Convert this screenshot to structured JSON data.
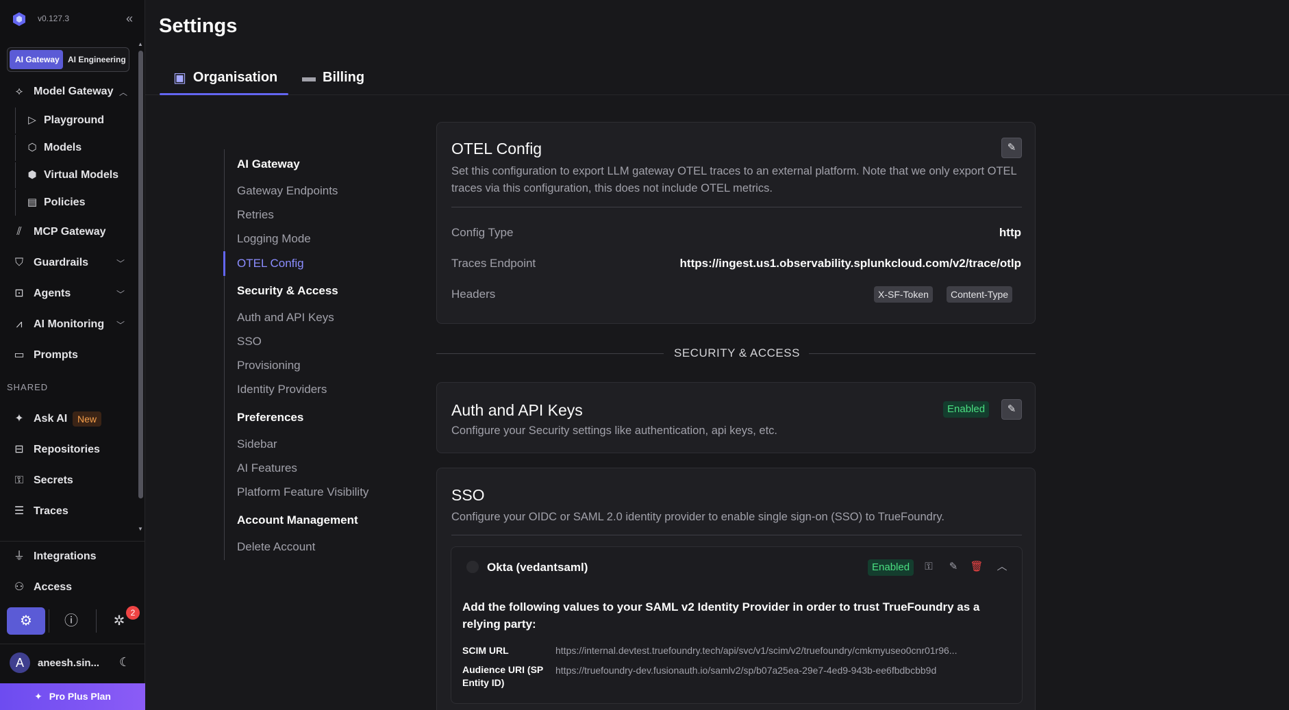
{
  "app": {
    "version": "v0.127.3",
    "page_title": "Settings"
  },
  "workspace_switcher": {
    "items": [
      "AI Gateway",
      "AI Engineering"
    ]
  },
  "sidebar": {
    "model_gateway": {
      "label": "Model Gateway",
      "children": [
        "Playground",
        "Models",
        "Virtual Models",
        "Policies"
      ]
    },
    "items": [
      {
        "label": "MCP Gateway"
      },
      {
        "label": "Guardrails"
      },
      {
        "label": "Agents"
      },
      {
        "label": "AI Monitoring"
      },
      {
        "label": "Prompts"
      }
    ],
    "shared_label": "SHARED",
    "shared_items": [
      {
        "label": "Ask AI",
        "badge": "New"
      },
      {
        "label": "Repositories"
      },
      {
        "label": "Secrets"
      },
      {
        "label": "Traces"
      }
    ],
    "footer_items": [
      {
        "label": "Integrations"
      },
      {
        "label": "Access"
      }
    ],
    "bug_count": "2",
    "user": {
      "initial": "A",
      "name": "aneesh.sin..."
    },
    "plan_label": "Pro Plus Plan"
  },
  "tabs": [
    {
      "label": "Organisation",
      "active": true
    },
    {
      "label": "Billing",
      "active": false
    }
  ],
  "subnav": {
    "groups": [
      {
        "heading": "AI Gateway",
        "items": [
          "Gateway Endpoints",
          "Retries",
          "Logging Mode",
          "OTEL Config"
        ]
      },
      {
        "heading": "Security & Access",
        "items": [
          "Auth and API Keys",
          "SSO",
          "Provisioning",
          "Identity Providers"
        ]
      },
      {
        "heading": "Preferences",
        "items": [
          "Sidebar",
          "AI Features",
          "Platform Feature Visibility"
        ]
      },
      {
        "heading": "Account Management",
        "items": [
          "Delete Account"
        ]
      }
    ],
    "active_item": "OTEL Config"
  },
  "otel": {
    "title": "OTEL Config",
    "description": "Set this configuration to export LLM gateway OTEL traces to an external platform. Note that we only export OTEL traces via this configuration, this does not include OTEL metrics.",
    "config_type_label": "Config Type",
    "config_type_value": "http",
    "endpoint_label": "Traces Endpoint",
    "endpoint_value": "https://ingest.us1.observability.splunkcloud.com/v2/trace/otlp",
    "headers_label": "Headers",
    "headers": [
      "X-SF-Token",
      "Content-Type"
    ]
  },
  "section_security": "SECURITY & ACCESS",
  "auth": {
    "title": "Auth and API Keys",
    "description": "Configure your Security settings like authentication, api keys, etc.",
    "status": "Enabled"
  },
  "sso": {
    "title": "SSO",
    "description": "Configure your OIDC or SAML 2.0 identity provider to enable single sign-on (SSO) to TrueFoundry.",
    "provider": {
      "name": "Okta (vedantsaml)",
      "status": "Enabled",
      "note": "Add the following values to your SAML v2 Identity Provider in order to trust TrueFoundry as a relying party:",
      "scim_label": "SCIM URL",
      "scim_value": "https://internal.devtest.truefoundry.tech/api/svc/v1/scim/v2/truefoundry/cmkmyuseo0cnr01r96...",
      "audience_label": "Audience URI (SP Entity ID)",
      "audience_value": "https://truefoundry-dev.fusionauth.io/samlv2/sp/b07a25ea-29e7-4ed9-943b-ee6fbdbcbb9d"
    }
  },
  "colors": {
    "accent": "#6366f1",
    "enabled_text": "#4ade80",
    "enabled_bg": "#143d2e",
    "danger": "#ef4444"
  }
}
